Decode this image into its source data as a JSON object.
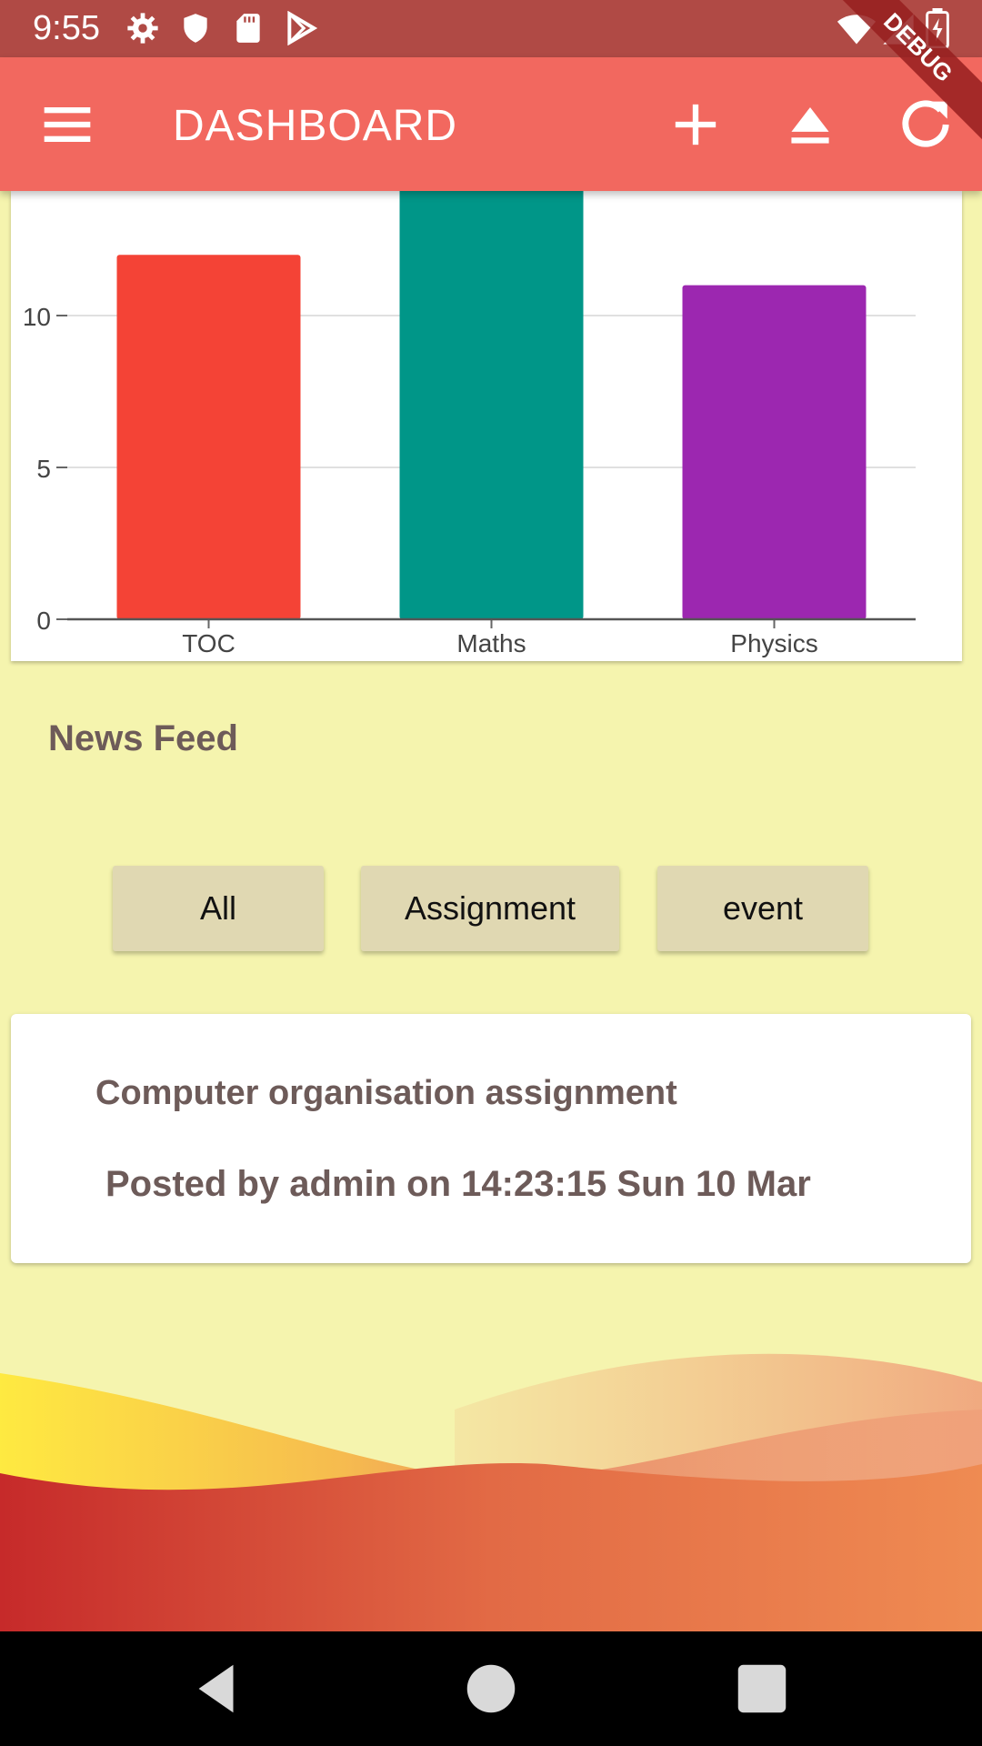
{
  "status_bar": {
    "time": "9:55",
    "icons": [
      "settings-icon",
      "shield-icon",
      "sd-card-icon",
      "play-store-icon",
      "wifi-icon",
      "signal-icon",
      "battery-icon"
    ]
  },
  "app_bar": {
    "title": "DASHBOARD",
    "actions": [
      "menu-icon",
      "add-icon",
      "eject-icon",
      "refresh-icon"
    ],
    "debug_banner": "DEBUG",
    "color": "#f2685f"
  },
  "chart_data": {
    "type": "bar",
    "categories": [
      "TOC",
      "Maths",
      "Physics"
    ],
    "values": [
      12,
      15,
      11
    ],
    "colors": [
      "#f44336",
      "#009688",
      "#9c27b0"
    ],
    "yticks": [
      0,
      5,
      10
    ],
    "ylim": [
      0,
      14
    ],
    "grid": true
  },
  "news_feed": {
    "title": "News Feed",
    "filters": [
      "All",
      "Assignment",
      "event"
    ],
    "items": [
      {
        "title": "Computer organisation assignment",
        "meta": "Posted by admin on 14:23:15 Sun 10 Mar"
      }
    ]
  },
  "nav_bar": {
    "buttons": [
      "back-icon",
      "home-icon",
      "recents-icon"
    ]
  }
}
